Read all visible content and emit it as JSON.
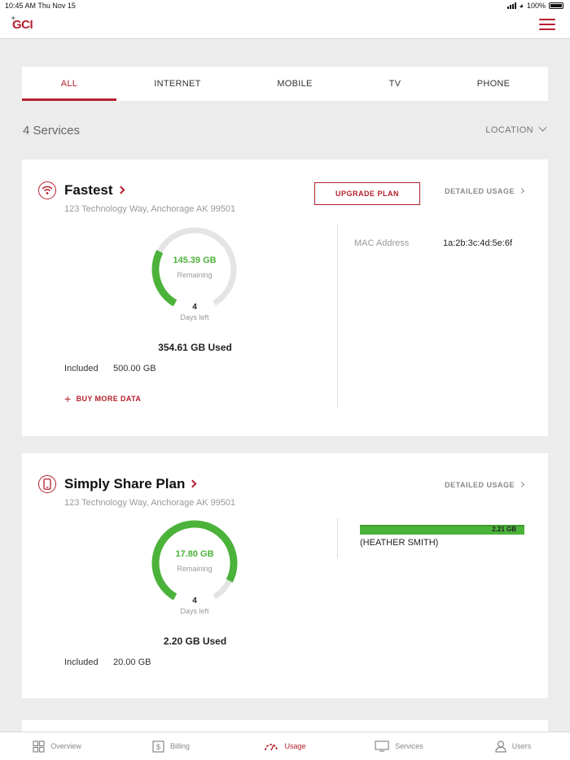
{
  "status_bar": {
    "time": "10:45 AM  Thu Nov 15",
    "battery": "100%"
  },
  "header": {
    "logo": "GCI"
  },
  "tabs": [
    {
      "label": "ALL",
      "active": true
    },
    {
      "label": "INTERNET"
    },
    {
      "label": "MOBILE"
    },
    {
      "label": "TV"
    },
    {
      "label": "PHONE"
    }
  ],
  "summary": {
    "count": "4 Services",
    "filter": "LOCATION"
  },
  "services": [
    {
      "name": "Fastest",
      "address": "123 Technology Way, Anchorage AK 99501",
      "upgrade_label": "UPGRADE PLAN",
      "detailed_label": "DETAILED USAGE",
      "remaining": "145.39 GB",
      "remaining_label": "Remaining",
      "days": "4",
      "days_label": "Days left",
      "used": "354.61 GB Used",
      "included_label": "Included",
      "included": "500.00 GB",
      "remaining_fraction": 0.29,
      "buy_label": "BUY MORE DATA",
      "mac_label": "MAC Address",
      "mac_value": "1a:2b:3c:4d:5e:6f"
    },
    {
      "name": "Simply Share Plan",
      "address": "123 Technology Way, Anchorage AK 99501",
      "detailed_label": "DETAILED USAGE",
      "remaining": "17.80 GB",
      "remaining_label": "Remaining",
      "days": "4",
      "days_label": "Days left",
      "used": "2.20 GB Used",
      "included_label": "Included",
      "included": "20.00 GB",
      "remaining_fraction": 0.89,
      "user_usage": "2.21 GB",
      "user_name": "(HEATHER SMITH)"
    }
  ],
  "bottom_nav": [
    {
      "label": "Overview",
      "icon": "grid-icon"
    },
    {
      "label": "Billing",
      "icon": "dollar-icon"
    },
    {
      "label": "Usage",
      "icon": "gauge-icon",
      "active": true
    },
    {
      "label": "Services",
      "icon": "monitor-icon"
    },
    {
      "label": "Users",
      "icon": "user-icon"
    }
  ],
  "colors": {
    "accent": "#b5202e",
    "usage_green": "#4bb23a",
    "track": "#e4e4e4"
  }
}
